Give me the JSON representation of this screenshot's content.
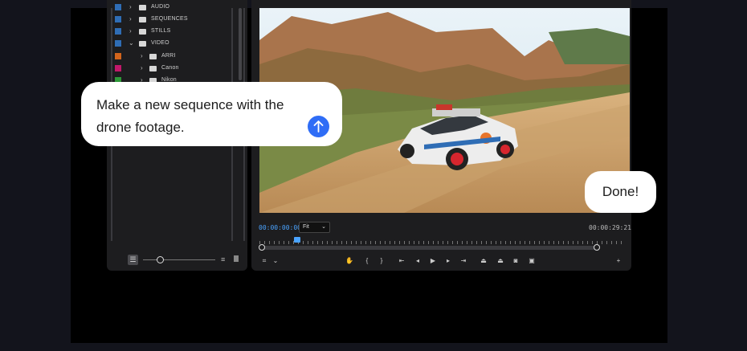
{
  "project_panel": {
    "items": [
      {
        "label": "AUDIO",
        "color": "#2f6db5",
        "indent": 0
      },
      {
        "label": "SEQUENCES",
        "color": "#2f6db5",
        "indent": 0
      },
      {
        "label": "STILLS",
        "color": "#2f6db5",
        "indent": 0
      },
      {
        "label": "VIDEO",
        "color": "#2f6db5",
        "indent": 0
      },
      {
        "label": "ARRI",
        "color": "#d2641c",
        "indent": 1
      },
      {
        "label": "Canon",
        "color": "#c2186a",
        "indent": 1
      },
      {
        "label": "Nikon",
        "color": "#2f9a3a",
        "indent": 1
      }
    ]
  },
  "monitor": {
    "timecode_current": "00:00:00:00",
    "zoom_fit": "Fit",
    "timecode_duration": "00:00:29:21"
  },
  "chat": {
    "prompt": "Make a new sequence with the drone footage.",
    "response": "Done!"
  },
  "colors": {
    "accent": "#4aa3ff",
    "send": "#2f6df6"
  }
}
